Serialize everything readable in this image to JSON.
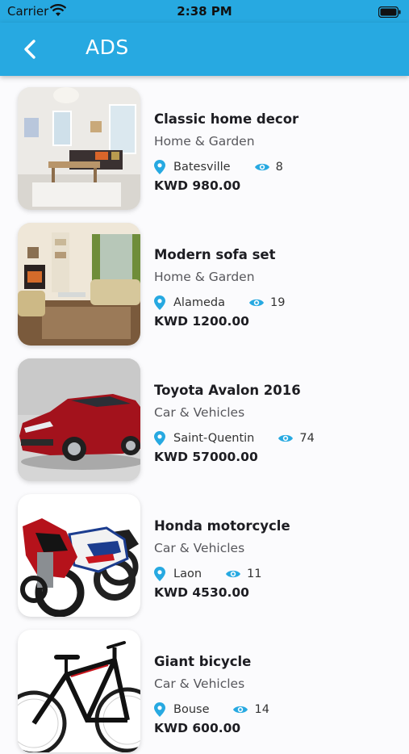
{
  "status_bar": {
    "carrier": "Carrier",
    "time": "2:38 PM"
  },
  "header": {
    "title": "ADS"
  },
  "colors": {
    "brand": "#27a9e1",
    "icon_accent": "#27a9e1"
  },
  "ads": [
    {
      "title": "Classic home decor",
      "category": "Home & Garden",
      "location": "Batesville",
      "views": "8",
      "price": "KWD 980.00",
      "image": "living-room-photo"
    },
    {
      "title": "Modern sofa set",
      "category": "Home & Garden",
      "location": "Alameda",
      "views": "19",
      "price": "KWD 1200.00",
      "image": "sofa-room-photo"
    },
    {
      "title": "Toyota Avalon 2016",
      "category": "Car & Vehicles",
      "location": "Saint-Quentin",
      "views": "74",
      "price": "KWD 57000.00",
      "image": "red-car-photo"
    },
    {
      "title": "Honda motorcycle",
      "category": "Car & Vehicles",
      "location": "Laon",
      "views": "11",
      "price": "KWD 4530.00",
      "image": "motorcycles-photo"
    },
    {
      "title": "Giant bicycle",
      "category": "Car & Vehicles",
      "location": "Bouse",
      "views": "14",
      "price": "KWD 600.00",
      "image": "bicycle-photo"
    }
  ]
}
